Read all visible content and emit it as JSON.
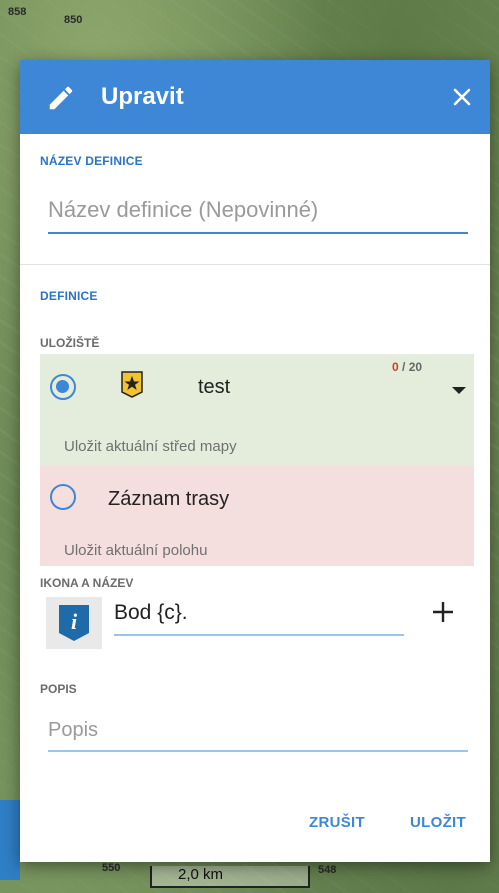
{
  "map": {
    "labels": [
      "858",
      "850",
      "550",
      "548"
    ],
    "scale": "2,0 km"
  },
  "dialog": {
    "title": "Upravit",
    "close_icon": "close-icon",
    "edit_icon": "pencil-icon"
  },
  "name_section": {
    "label": "NÁZEV DEFINICE",
    "placeholder": "Název definice (Nepovinné)",
    "value": ""
  },
  "definition_section": {
    "label": "DEFINICE",
    "storage_label": "ULOŽIŠTĚ",
    "options": [
      {
        "name": "test",
        "counter_used": "0",
        "counter_total": "/ 20",
        "hint": "Uložit aktuální střed mapy",
        "selected": true,
        "color": "#e4eddb"
      },
      {
        "name": "Záznam trasy",
        "hint": "Uložit aktuální polohu",
        "selected": false,
        "color": "#f5dede"
      }
    ]
  },
  "icon_name_section": {
    "label": "IKONA A NÁZEV",
    "icon": "info-point-icon",
    "value": "Bod {c}.",
    "add_icon": "plus-icon"
  },
  "description_section": {
    "label": "POPIS",
    "placeholder": "Popis",
    "value": ""
  },
  "actions": {
    "cancel_label": "ZRUŠIT",
    "save_label": "ULOŽIT"
  },
  "colors": {
    "accent": "#3e86d6",
    "counter_red": "#d43a2a"
  }
}
